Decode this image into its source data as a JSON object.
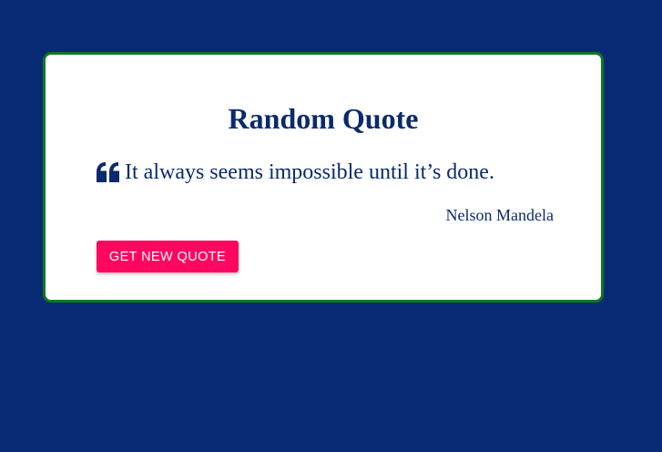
{
  "page": {
    "background": "#062a73"
  },
  "card": {
    "title": "Random Quote",
    "quote_icon": "quote-left-icon",
    "quote": "It always seems impossible until it’s done.",
    "author": "Nelson Mandela",
    "button_label": "GET NEW QUOTE",
    "border_color": "#0b7a1f",
    "text_color": "#0a2a6e",
    "button_color": "#ff0760"
  }
}
